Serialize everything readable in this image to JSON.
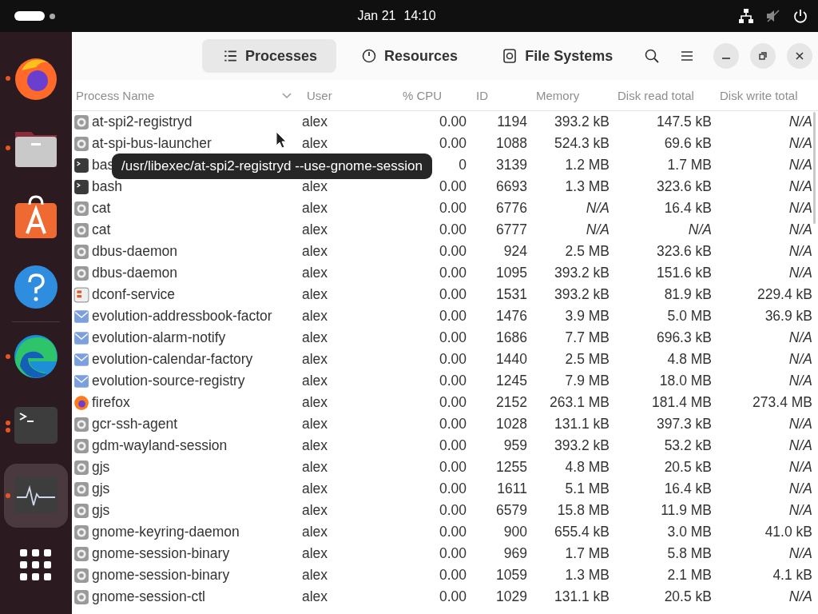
{
  "top_bar": {
    "date": "Jan 21",
    "time": "14:10",
    "muted": true
  },
  "dock": {
    "items": [
      {
        "kind": "firefox",
        "running": true,
        "multiple_windows": false,
        "selected": false
      },
      {
        "kind": "files",
        "running": true,
        "multiple_windows": false,
        "selected": false
      },
      {
        "kind": "store",
        "running": false,
        "selected": false
      },
      {
        "kind": "help",
        "running": false,
        "selected": false
      },
      {
        "kind": "edge",
        "running": true,
        "multiple_windows": false,
        "selected": false
      },
      {
        "kind": "terminal",
        "running": true,
        "multiple_windows": true,
        "selected": false
      },
      {
        "kind": "monitor",
        "running": true,
        "multiple_windows": false,
        "selected": true
      }
    ]
  },
  "header": {
    "tabs": [
      {
        "label": "Processes",
        "kind": "list",
        "selected": true
      },
      {
        "label": "Resources",
        "kind": "gauge",
        "selected": false
      },
      {
        "label": "File Systems",
        "kind": "disk",
        "selected": false
      }
    ]
  },
  "table": {
    "columns": [
      "Process Name",
      "User",
      "% CPU",
      "ID",
      "Memory",
      "Disk read total",
      "Disk write total"
    ],
    "rows": [
      {
        "kind": "gear",
        "name": "at-spi2-registryd",
        "user": "alex",
        "cpu": "0.00",
        "id": "1194",
        "memory": {
          "text": "393.2 kB"
        },
        "read": {
          "text": "147.5 kB"
        },
        "write": {
          "text": "N/A",
          "na": true
        }
      },
      {
        "kind": "gear",
        "name": "at-spi-bus-launcher",
        "user": "alex",
        "cpu": "0.00",
        "id": "1088",
        "memory": {
          "text": "524.3 kB"
        },
        "read": {
          "text": "69.6 kB"
        },
        "write": {
          "text": "N/A",
          "na": true
        }
      },
      {
        "kind": "terminal",
        "name": "bas",
        "cpu": "0",
        "id": "3139",
        "memory": {
          "text": "1.2 MB"
        },
        "read": {
          "text": "1.7 MB"
        },
        "write": {
          "text": "N/A",
          "na": true
        }
      },
      {
        "kind": "terminal",
        "name": "bash",
        "user": "alex",
        "cpu": "0.00",
        "id": "6693",
        "memory": {
          "text": "1.3 MB"
        },
        "read": {
          "text": "323.6 kB"
        },
        "write": {
          "text": "N/A",
          "na": true
        }
      },
      {
        "kind": "gear",
        "name": "cat",
        "user": "alex",
        "cpu": "0.00",
        "id": "6776",
        "memory": {
          "text": "N/A",
          "na": true
        },
        "read": {
          "text": "16.4 kB"
        },
        "write": {
          "text": "N/A",
          "na": true
        }
      },
      {
        "kind": "gear",
        "name": "cat",
        "user": "alex",
        "cpu": "0.00",
        "id": "6777",
        "memory": {
          "text": "N/A",
          "na": true
        },
        "read": {
          "text": "N/A",
          "na": true
        },
        "write": {
          "text": "N/A",
          "na": true
        }
      },
      {
        "kind": "gear",
        "name": "dbus-daemon",
        "user": "alex",
        "cpu": "0.00",
        "id": "924",
        "memory": {
          "text": "2.5 MB"
        },
        "read": {
          "text": "323.6 kB"
        },
        "write": {
          "text": "N/A",
          "na": true
        }
      },
      {
        "kind": "gear",
        "name": "dbus-daemon",
        "user": "alex",
        "cpu": "0.00",
        "id": "1095",
        "memory": {
          "text": "393.2 kB"
        },
        "read": {
          "text": "151.6 kB"
        },
        "write": {
          "text": "N/A",
          "na": true
        }
      },
      {
        "kind": "dconf",
        "name": "dconf-service",
        "user": "alex",
        "cpu": "0.00",
        "id": "1531",
        "memory": {
          "text": "393.2 kB"
        },
        "read": {
          "text": "81.9 kB"
        },
        "write": {
          "text": "229.4 kB"
        }
      },
      {
        "kind": "mail",
        "name": "evolution-addressbook-factor",
        "user": "alex",
        "cpu": "0.00",
        "id": "1476",
        "memory": {
          "text": "3.9 MB"
        },
        "read": {
          "text": "5.0 MB"
        },
        "write": {
          "text": "36.9 kB"
        }
      },
      {
        "kind": "mail",
        "name": "evolution-alarm-notify",
        "user": "alex",
        "cpu": "0.00",
        "id": "1686",
        "memory": {
          "text": "7.7 MB"
        },
        "read": {
          "text": "696.3 kB"
        },
        "write": {
          "text": "N/A",
          "na": true
        }
      },
      {
        "kind": "mail",
        "name": "evolution-calendar-factory",
        "user": "alex",
        "cpu": "0.00",
        "id": "1440",
        "memory": {
          "text": "2.5 MB"
        },
        "read": {
          "text": "4.8 MB"
        },
        "write": {
          "text": "N/A",
          "na": true
        }
      },
      {
        "kind": "mail",
        "name": "evolution-source-registry",
        "user": "alex",
        "cpu": "0.00",
        "id": "1245",
        "memory": {
          "text": "7.9 MB"
        },
        "read": {
          "text": "18.0 MB"
        },
        "write": {
          "text": "N/A",
          "na": true
        }
      },
      {
        "kind": "firefox",
        "name": "firefox",
        "user": "alex",
        "cpu": "0.00",
        "id": "2152",
        "memory": {
          "text": "263.1 MB"
        },
        "read": {
          "text": "181.4 MB"
        },
        "write": {
          "text": "273.4 MB"
        }
      },
      {
        "kind": "gear",
        "name": "gcr-ssh-agent",
        "user": "alex",
        "cpu": "0.00",
        "id": "1028",
        "memory": {
          "text": "131.1 kB"
        },
        "read": {
          "text": "397.3 kB"
        },
        "write": {
          "text": "N/A",
          "na": true
        }
      },
      {
        "kind": "gear",
        "name": "gdm-wayland-session",
        "user": "alex",
        "cpu": "0.00",
        "id": "959",
        "memory": {
          "text": "393.2 kB"
        },
        "read": {
          "text": "53.2 kB"
        },
        "write": {
          "text": "N/A",
          "na": true
        }
      },
      {
        "kind": "gear",
        "name": "gjs",
        "user": "alex",
        "cpu": "0.00",
        "id": "1255",
        "memory": {
          "text": "4.8 MB"
        },
        "read": {
          "text": "20.5 kB"
        },
        "write": {
          "text": "N/A",
          "na": true
        }
      },
      {
        "kind": "gear",
        "name": "gjs",
        "user": "alex",
        "cpu": "0.00",
        "id": "1611",
        "memory": {
          "text": "5.1 MB"
        },
        "read": {
          "text": "16.4 kB"
        },
        "write": {
          "text": "N/A",
          "na": true
        }
      },
      {
        "kind": "gear",
        "name": "gjs",
        "user": "alex",
        "cpu": "0.00",
        "id": "6579",
        "memory": {
          "text": "15.8 MB"
        },
        "read": {
          "text": "11.9 MB"
        },
        "write": {
          "text": "N/A",
          "na": true
        }
      },
      {
        "kind": "gear",
        "name": "gnome-keyring-daemon",
        "user": "alex",
        "cpu": "0.00",
        "id": "900",
        "memory": {
          "text": "655.4 kB"
        },
        "read": {
          "text": "3.0 MB"
        },
        "write": {
          "text": "41.0 kB"
        }
      },
      {
        "kind": "gear",
        "name": "gnome-session-binary",
        "user": "alex",
        "cpu": "0.00",
        "id": "969",
        "memory": {
          "text": "1.7 MB"
        },
        "read": {
          "text": "5.8 MB"
        },
        "write": {
          "text": "N/A",
          "na": true
        }
      },
      {
        "kind": "gear",
        "name": "gnome-session-binary",
        "user": "alex",
        "cpu": "0.00",
        "id": "1059",
        "memory": {
          "text": "1.3 MB"
        },
        "read": {
          "text": "2.1 MB"
        },
        "write": {
          "text": "4.1 kB"
        }
      },
      {
        "kind": "gear",
        "name": "gnome-session-ctl",
        "user": "alex",
        "cpu": "0.00",
        "id": "1029",
        "memory": {
          "text": "131.1 kB"
        },
        "read": {
          "text": "20.5 kB"
        },
        "write": {
          "text": "N/A",
          "na": true
        }
      }
    ]
  },
  "tooltip": {
    "text": "/usr/libexec/at-spi2-registryd --use-gnome-session"
  }
}
